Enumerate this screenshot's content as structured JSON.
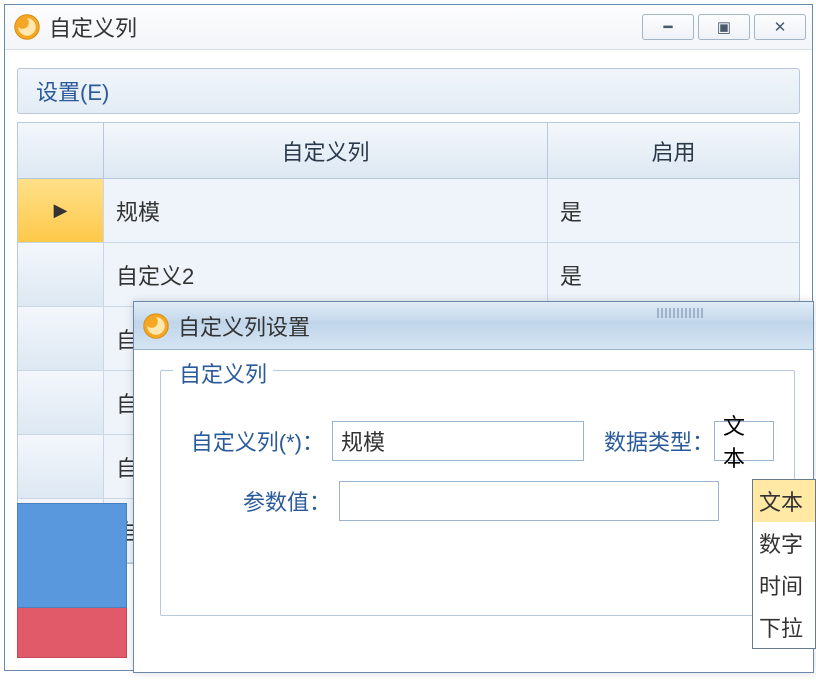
{
  "main_window": {
    "title": "自定义列",
    "menu": {
      "settings": "设置(E)"
    },
    "grid": {
      "headers": {
        "selector": "",
        "col1": "自定义列",
        "col2": "启用"
      },
      "rows": [
        {
          "selected": true,
          "col1": "规模",
          "col2": "是"
        },
        {
          "selected": false,
          "col1": "自定义2",
          "col2": "是"
        },
        {
          "selected": false,
          "col1": "自",
          "col2": ""
        },
        {
          "selected": false,
          "col1": "自",
          "col2": ""
        },
        {
          "selected": false,
          "col1": "自",
          "col2": ""
        },
        {
          "selected": false,
          "col1": "自",
          "col2": ""
        }
      ]
    }
  },
  "dialog": {
    "title": "自定义列设置",
    "legend": "自定义列",
    "field_name_label": "自定义列(*)：",
    "field_name_value": "规模",
    "field_type_label": "数据类型：",
    "field_type_value": "文本",
    "field_param_label": "参数值：",
    "field_param_value": ""
  },
  "dropdown": {
    "options": [
      "文本",
      "数字",
      "时间",
      "下拉"
    ]
  },
  "icons": {
    "app": "app-icon"
  }
}
